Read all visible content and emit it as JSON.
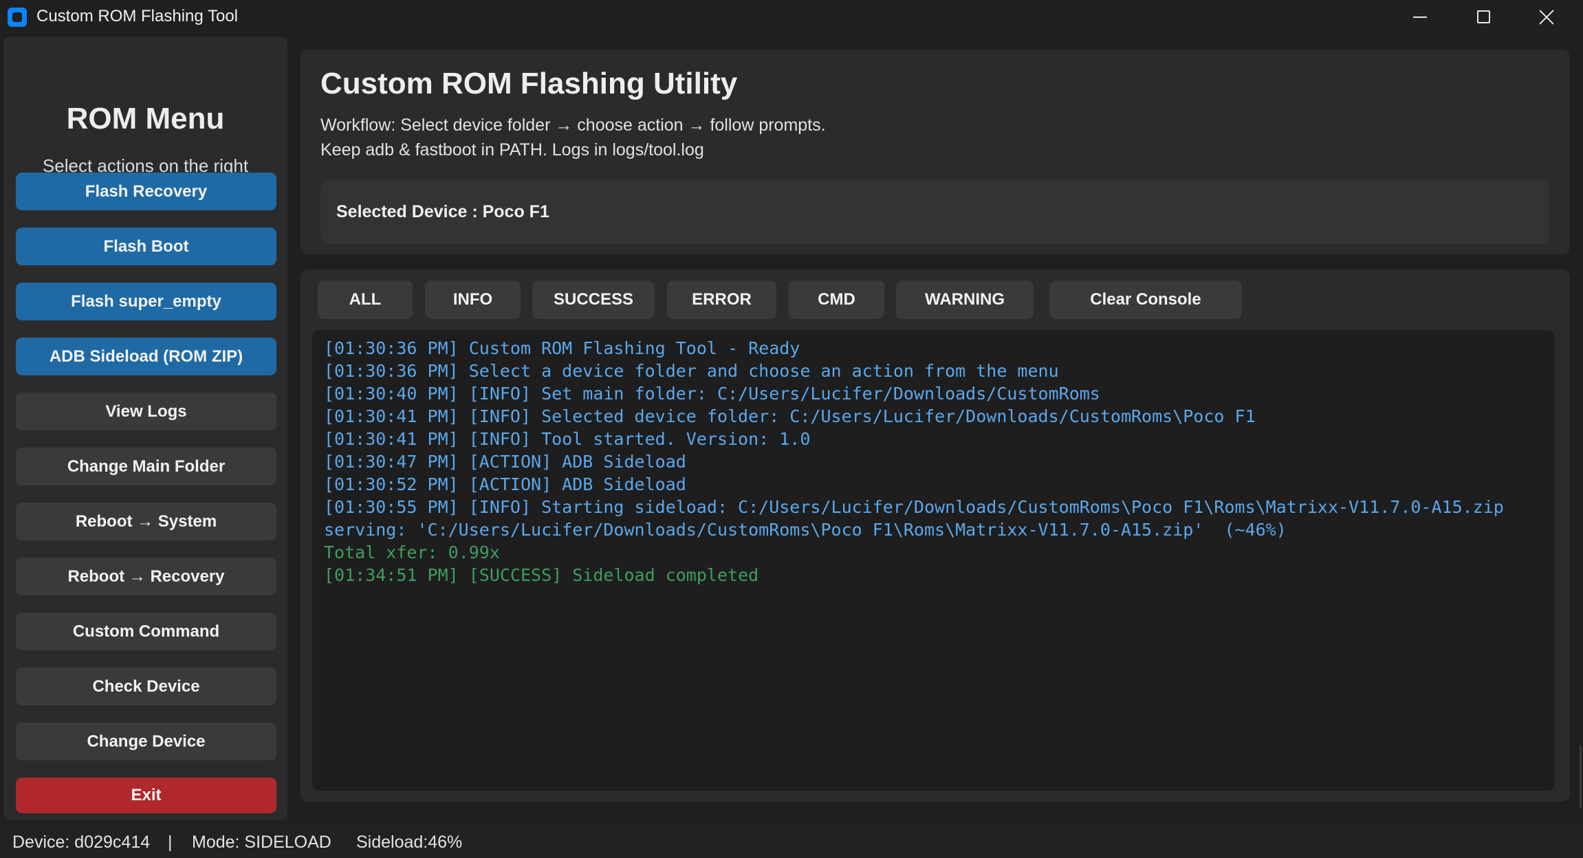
{
  "window": {
    "title": "Custom ROM Flashing Tool"
  },
  "sidebar": {
    "title": "ROM Menu",
    "subtitle": "Select actions on the right",
    "buttons": [
      {
        "label": "Flash Recovery"
      },
      {
        "label": "Flash Boot"
      },
      {
        "label": "Flash super_empty"
      },
      {
        "label": "ADB Sideload (ROM ZIP)"
      },
      {
        "label": "View Logs"
      },
      {
        "label": "Change Main Folder"
      },
      {
        "label": "Reboot → System"
      },
      {
        "label": "Reboot → Recovery"
      },
      {
        "label": "Custom Command"
      },
      {
        "label": "Check Device"
      },
      {
        "label": "Change Device"
      },
      {
        "label": "Exit"
      }
    ]
  },
  "header": {
    "title": "Custom ROM Flashing Utility",
    "workflow": "Workflow: Select device folder → choose action → follow prompts.",
    "path_note": "Keep adb & fastboot in PATH. Logs in logs/tool.log",
    "selected_device": "Selected Device : Poco F1"
  },
  "filters": [
    {
      "label": "ALL"
    },
    {
      "label": "INFO"
    },
    {
      "label": "SUCCESS"
    },
    {
      "label": "ERROR"
    },
    {
      "label": "CMD"
    },
    {
      "label": "WARNING"
    },
    {
      "label": "Clear Console"
    }
  ],
  "console": {
    "lines": [
      {
        "text": "[01:30:36 PM] Custom ROM Flashing Tool - Ready"
      },
      {
        "text": "[01:30:36 PM] Select a device folder and choose an action from the menu"
      },
      {
        "text": "[01:30:40 PM] [INFO] Set main folder: C:/Users/Lucifer/Downloads/CustomRoms"
      },
      {
        "text": "[01:30:41 PM] [INFO] Selected device folder: C:/Users/Lucifer/Downloads/CustomRoms\\Poco F1"
      },
      {
        "text": "[01:30:41 PM] [INFO] Tool started. Version: 1.0"
      },
      {
        "text": "[01:30:47 PM] [ACTION] ADB Sideload"
      },
      {
        "text": "[01:30:52 PM] [ACTION] ADB Sideload"
      },
      {
        "text": "[01:30:55 PM] [INFO] Starting sideload: C:/Users/Lucifer/Downloads/CustomRoms\\Poco F1\\Roms\\Matrixx-V11.7.0-A15.zip"
      },
      {
        "text": "serving: 'C:/Users/Lucifer/Downloads/CustomRoms\\Poco F1\\Roms\\Matrixx-V11.7.0-A15.zip'  (~46%)"
      },
      {
        "text": "Total xfer: 0.99x"
      },
      {
        "text": "[01:34:51 PM] [SUCCESS] Sideload completed"
      }
    ]
  },
  "status": {
    "device": "Device: d029c414",
    "separator": "|",
    "mode": "Mode: SIDELOAD",
    "sideload": "Sideload:46%"
  },
  "colors": {
    "primary_button": "#1f6aa5",
    "danger_button": "#b0282b",
    "info_text": "#5aa8ec",
    "success_text": "#3f9d5f"
  }
}
